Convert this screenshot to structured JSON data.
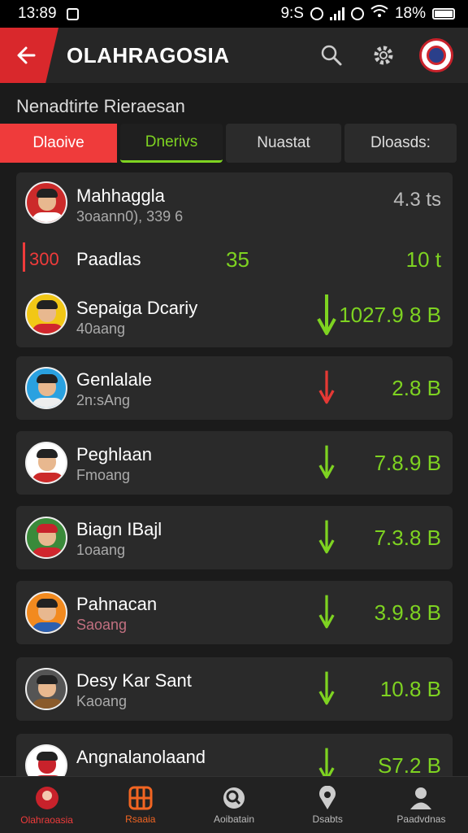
{
  "status_bar": {
    "time": "13:89",
    "clock2": "9:S",
    "battery": "18%"
  },
  "header": {
    "title": "OLAHRAGOSIA"
  },
  "section_title": "Nenadtirte Rieraesan",
  "tabs": [
    "Dlaoive",
    "Dnerivs",
    "Nuastat",
    "Dloasds:"
  ],
  "players": [
    {
      "name": "Mahhaggla",
      "sub": "3oaann0), 339 6",
      "value": "4.3 ts",
      "extra_rank": "300",
      "extra_label": "Paadlas",
      "extra_mid": "35",
      "extra_value": "10 t"
    },
    {
      "name": "Sepaiga Dcariy",
      "sub": "40aang",
      "value": "1027.9 8 B",
      "trend": "down",
      "color": "#7ed321"
    },
    {
      "name": "Genlalale",
      "sub": "2n:sAng",
      "value": "2.8 B",
      "trend": "down",
      "color": "#e53935"
    },
    {
      "name": "Peghlaan",
      "sub": "Fmoang",
      "value": "7.8.9 B",
      "trend": "down",
      "color": "#7ed321"
    },
    {
      "name": "Biagn IBajl",
      "sub": "1oaang",
      "value": "7.3.8 B",
      "trend": "down",
      "color": "#7ed321"
    },
    {
      "name": "Pahnacan",
      "sub": "Saoang",
      "value": "3.9.8 B",
      "trend": "down",
      "color": "#7ed321"
    },
    {
      "name": "Desy Kar Sant",
      "sub": "Kaoang",
      "value": "10.8 B",
      "trend": "down",
      "color": "#7ed321"
    },
    {
      "name": "Angnalanolaand",
      "sub": "",
      "value": "S7.2 B",
      "trend": "down",
      "color": "#7ed321"
    }
  ],
  "bottom_nav": [
    "Olahraoasia",
    "Rsaaia",
    "Aoibatain",
    "Dsabts",
    "Paadvdnas"
  ],
  "colors": {
    "accent_red": "#ef3b3b",
    "accent_green": "#7ed321",
    "background": "#1b1b1b"
  }
}
